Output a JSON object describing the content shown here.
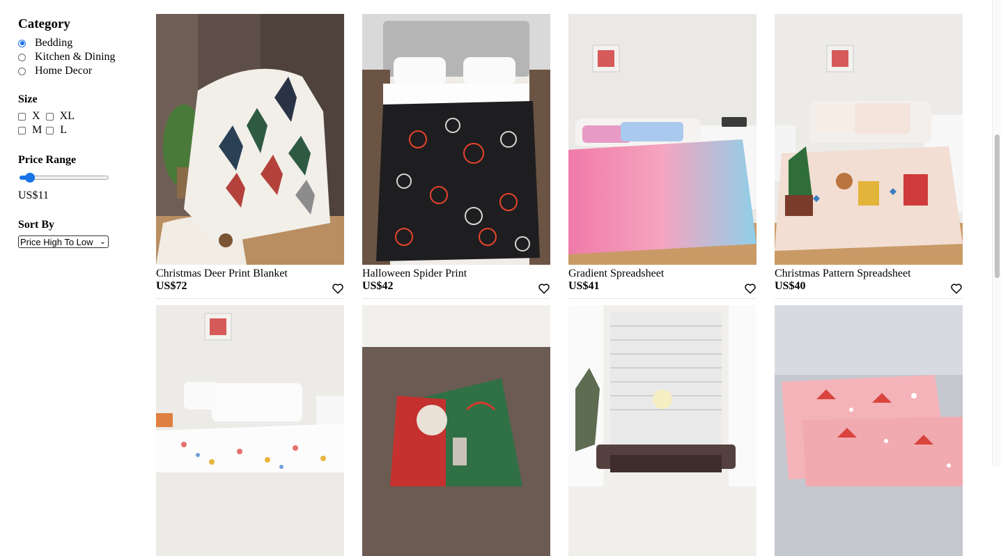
{
  "filters": {
    "category_title": "Category",
    "categories": [
      {
        "label": "Bedding",
        "checked": true
      },
      {
        "label": "Kitchen & Dining",
        "checked": false
      },
      {
        "label": "Home Decor",
        "checked": false
      }
    ],
    "size_title": "Size",
    "sizes": [
      {
        "label": "X"
      },
      {
        "label": "XL"
      },
      {
        "label": "M"
      },
      {
        "label": "L"
      }
    ],
    "price_title": "Price Range",
    "price_value": "US$11",
    "price_slider_fraction": 0.06,
    "sort_title": "Sort By",
    "sort_selected": "Price High To Low"
  },
  "products": [
    {
      "name": "Christmas Deer Print Blanket",
      "price": "US$72",
      "image": "deer-print-blanket-on-chair"
    },
    {
      "name": "Halloween Spider Print",
      "price": "US$42",
      "image": "black-spiderweb-bed"
    },
    {
      "name": "Gradient Spreadsheet",
      "price": "US$41",
      "image": "pink-blue-gradient-bed"
    },
    {
      "name": "Christmas Pattern Spreadsheet",
      "price": "US$40",
      "image": "gingerbread-christmas-bed"
    },
    {
      "name": "",
      "price": "",
      "image": "star-print-bed"
    },
    {
      "name": "",
      "price": "",
      "image": "santa-blanket"
    },
    {
      "name": "",
      "price": "",
      "image": "window-christmas-bed"
    },
    {
      "name": "",
      "price": "",
      "image": "pink-santa-pillows"
    }
  ],
  "colors": {
    "accent": "#1a73e8",
    "divider": "#e3e3e3"
  }
}
